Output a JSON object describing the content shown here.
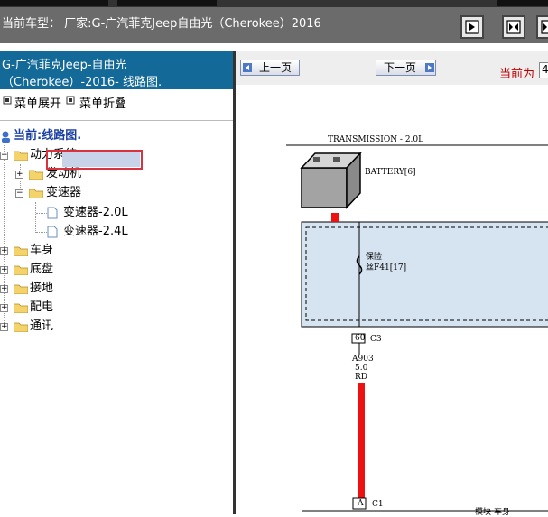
{
  "header": {
    "car_info": "当前车型： 厂家:G-广汽菲克Jeep自由光（Cherokee）2016",
    "buttons": [
      {
        "name": "first-page-button",
        "icon": "play-icon"
      },
      {
        "name": "fit-width-button",
        "icon": "fit-icon"
      },
      {
        "name": "fit-page-button",
        "icon": "fit-icon"
      }
    ]
  },
  "left": {
    "title_line1": "G-广汽菲克Jeep-自由光",
    "title_line2": "（Cherokee）-2016- 线路图.",
    "expand_label": "菜单展开",
    "collapse_label": "菜单折叠",
    "current_label": "当前:线路图.",
    "tree": {
      "power_system": "动力系统",
      "engine": "发动机",
      "transmission": "变速器",
      "trans_20": "变速器-2.0L",
      "trans_24": "变速器-2.4L",
      "body": "车身",
      "chassis": "底盘",
      "ground": "接地",
      "power_dist": "配电",
      "comm": "通讯"
    }
  },
  "right": {
    "prev_label": "上一页",
    "next_label": "下一页",
    "current_page_label": "当前为",
    "current_page_value": "4",
    "diagram": {
      "title": "TRANSMISSION - 2.0L",
      "battery": "BATTERY[6]",
      "fuse_name": "保险",
      "fuse_id": "丝F41[17]",
      "connector_pin": "60",
      "connector_name": "C3",
      "wire_id": "A903",
      "wire_gauge": "5.0",
      "wire_color": "RD",
      "bottom_pin": "A",
      "bottom_connector": "C1",
      "bottom_module": "模块-车身"
    }
  },
  "colors": {
    "header_bg": "#6b6b6b",
    "left_title_bg": "#136997",
    "selection_border": "#d9333f",
    "wire_red": "#ee1111",
    "fuse_box_fill": "#d6e4f2",
    "current_page_label": "#c00000"
  }
}
